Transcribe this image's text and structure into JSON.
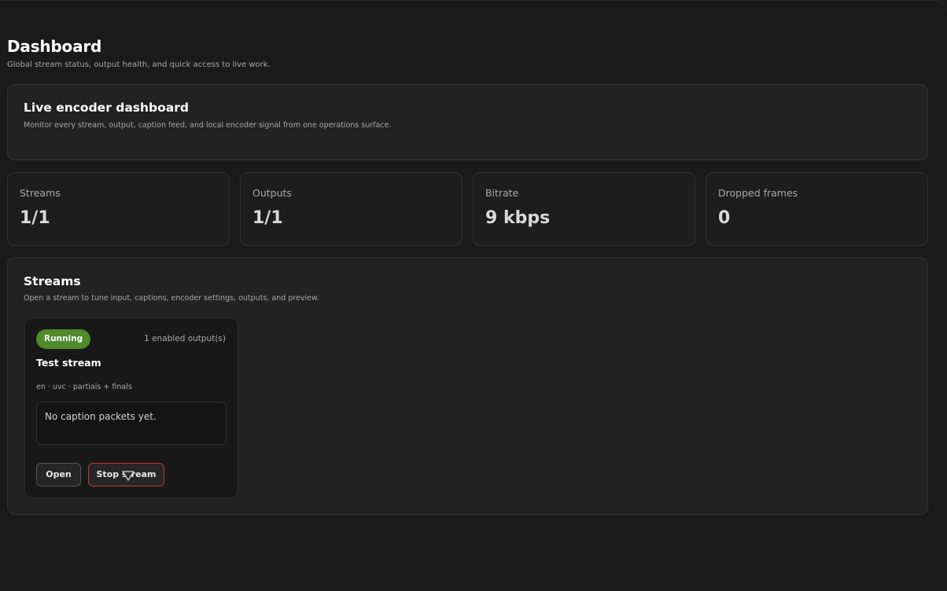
{
  "page": {
    "title": "Dashboard",
    "subtitle": "Global stream status, output health, and quick access to live work."
  },
  "hero": {
    "title": "Live encoder dashboard",
    "subtitle": "Monitor every stream, output, caption feed, and local encoder signal from one operations surface."
  },
  "stats": [
    {
      "label": "Streams",
      "value": "1/1"
    },
    {
      "label": "Outputs",
      "value": "1/1"
    },
    {
      "label": "Bitrate",
      "value": "9 kbps"
    },
    {
      "label": "Dropped frames",
      "value": "0"
    }
  ],
  "streams": {
    "title": "Streams",
    "subtitle": "Open a stream to tune input, captions, encoder settings, outputs, and preview.",
    "items": [
      {
        "status": "Running",
        "outputs": "1 enabled output(s)",
        "name": "Test stream",
        "meta": "en · uvc · partials + finals",
        "caption": "No caption packets yet.",
        "open_label": "Open",
        "stop_label": "Stop stream"
      }
    ]
  },
  "colors": {
    "background": "#1a1a1a",
    "panel": "#222222",
    "running_badge": "#4f8a2b",
    "stop_border": "#c23a34"
  },
  "icons": {
    "cursor": "pointer-cursor-icon"
  }
}
